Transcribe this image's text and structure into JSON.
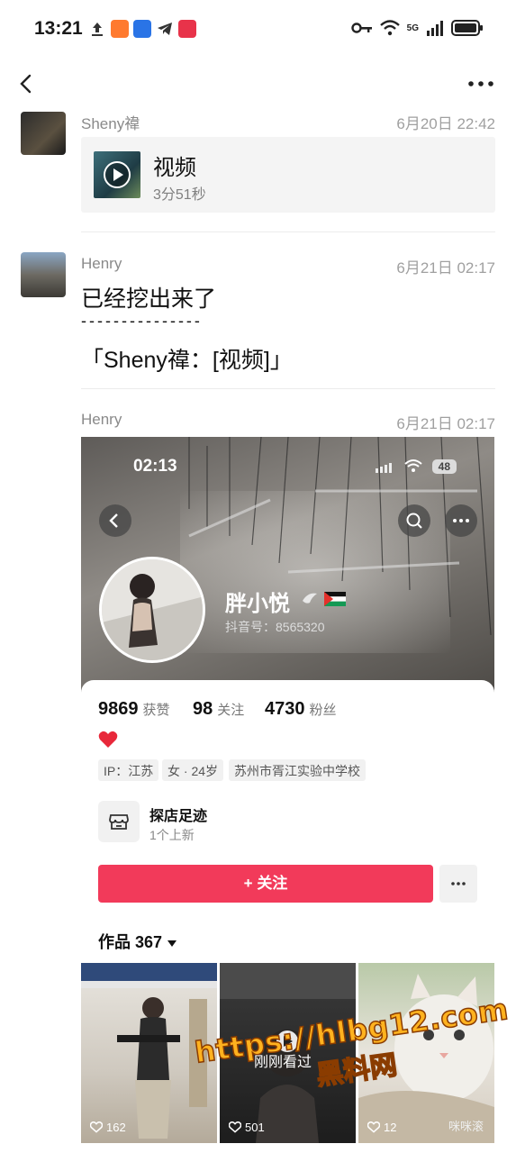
{
  "status_bar": {
    "time": "13:21",
    "network": "5G"
  },
  "nav": {
    "back_icon": "chevron-left-icon",
    "more_icon": "more-horizontal-icon"
  },
  "messages": [
    {
      "sender": "Sheny禕",
      "time": "6月20日 22:42",
      "video": {
        "title": "视频",
        "duration": "3分51秒"
      }
    },
    {
      "sender": "Henry",
      "time": "6月21日 02:17",
      "lines": [
        "已经挖出来了",
        "- - - - - - - - - - - - - - -",
        "「Sheny禕：[视频]」"
      ]
    },
    {
      "sender": "Henry",
      "time": "6月21日 02:17"
    }
  ],
  "shared_image": {
    "status_time": "02:13",
    "battery": "48",
    "profile": {
      "name": "胖小悦",
      "id_label": "抖音号：8565320",
      "stats": [
        {
          "value": "9869",
          "label": "获赞"
        },
        {
          "value": "98",
          "label": "关注"
        },
        {
          "value": "4730",
          "label": "粉丝"
        }
      ],
      "tags": [
        "IP：江苏",
        "女 · 24岁",
        "苏州市胥江实验中学校"
      ],
      "shop": {
        "title": "探店足迹",
        "subtitle": "1个上新"
      },
      "follow_label": "+ 关注",
      "works_label": "作品 367",
      "tiles": [
        {
          "likes": "162",
          "caption": ""
        },
        {
          "likes": "501",
          "caption": "",
          "overlay": "刚刚看过"
        },
        {
          "likes": "12",
          "caption": "咪咪滚"
        }
      ]
    }
  },
  "watermark": {
    "url": "https://hlbg12.com",
    "text": "黑料网"
  },
  "colors": {
    "follow_button": "#f23a5a",
    "watermark": "#ffb21f"
  }
}
